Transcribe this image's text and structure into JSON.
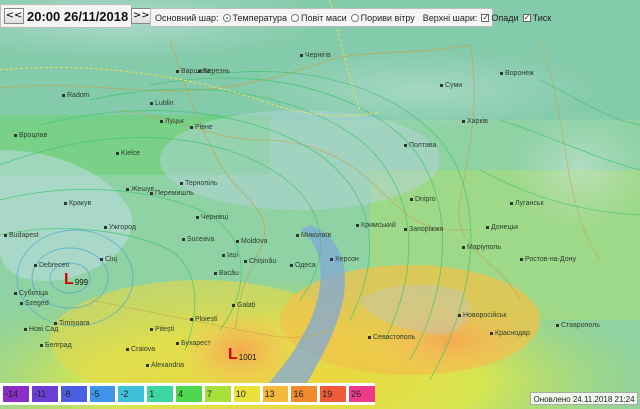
{
  "timebar": {
    "prev_label": "<<",
    "datetime": "20:00 26/11/2018",
    "next_label": ">>"
  },
  "layers": {
    "base_label": "Основний шар:",
    "base_options": [
      {
        "label": "Температура",
        "selected": true
      },
      {
        "label": "Повіт маси",
        "selected": false
      },
      {
        "label": "Пориви вітру",
        "selected": false
      }
    ],
    "top_label": "Верхні шари:",
    "top_options": [
      {
        "label": "Опади",
        "checked": true
      },
      {
        "label": "Тиск",
        "checked": true
      }
    ]
  },
  "lows": [
    {
      "letter": "L",
      "pressure": "999"
    },
    {
      "letter": "L",
      "pressure": "1001"
    }
  ],
  "legend": {
    "values": [
      "-14",
      "-11",
      "-8",
      "-5",
      "-2",
      "1",
      "4",
      "7",
      "10",
      "13",
      "16",
      "19",
      "26"
    ],
    "colors": [
      "#8a2ec8",
      "#6b3fd6",
      "#4a5fe4",
      "#3f93e8",
      "#3dc0d8",
      "#3ed6a0",
      "#4fd84f",
      "#a8e03a",
      "#e8e23a",
      "#f4b83a",
      "#f08a2a",
      "#ee5a3a",
      "#ee3a8a"
    ]
  },
  "updated": "Оновлено 24.11.2018 21:24",
  "cities": [
    "Варшава",
    "Вроцлав",
    "Radom",
    "Lublin",
    "Kielce",
    "Кракув",
    "Перемишль",
    "Жешув",
    "Березнь",
    "Луцьк",
    "Рівне",
    "Тернопіль",
    "Чернівці",
    "Ужгород",
    "Чернігів",
    "Воронеж",
    "Харків",
    "Полтава",
    "Суми",
    "Dnipro",
    "Луганськ",
    "Донецьк",
    "Маріуполь",
    "Запоріжжя",
    "Херсон",
    "Миколаїв",
    "Одеса",
    "Chișinău",
    "Moldova",
    "Iași",
    "Suceava",
    "Galați",
    "Бухарест",
    "Ploiești",
    "Craiova",
    "Alexandria",
    "Кримський",
    "Севастополь",
    "Краснодар",
    "Ростов-на-Дону",
    "Ставрополь",
    "Cluj",
    "Debrecen",
    "Budapest",
    "Szeged",
    "Timișoara",
    "Нові Сад",
    "Белград",
    "Суботіца",
    "Pitești",
    "Bacău",
    "Новоросійськ"
  ]
}
